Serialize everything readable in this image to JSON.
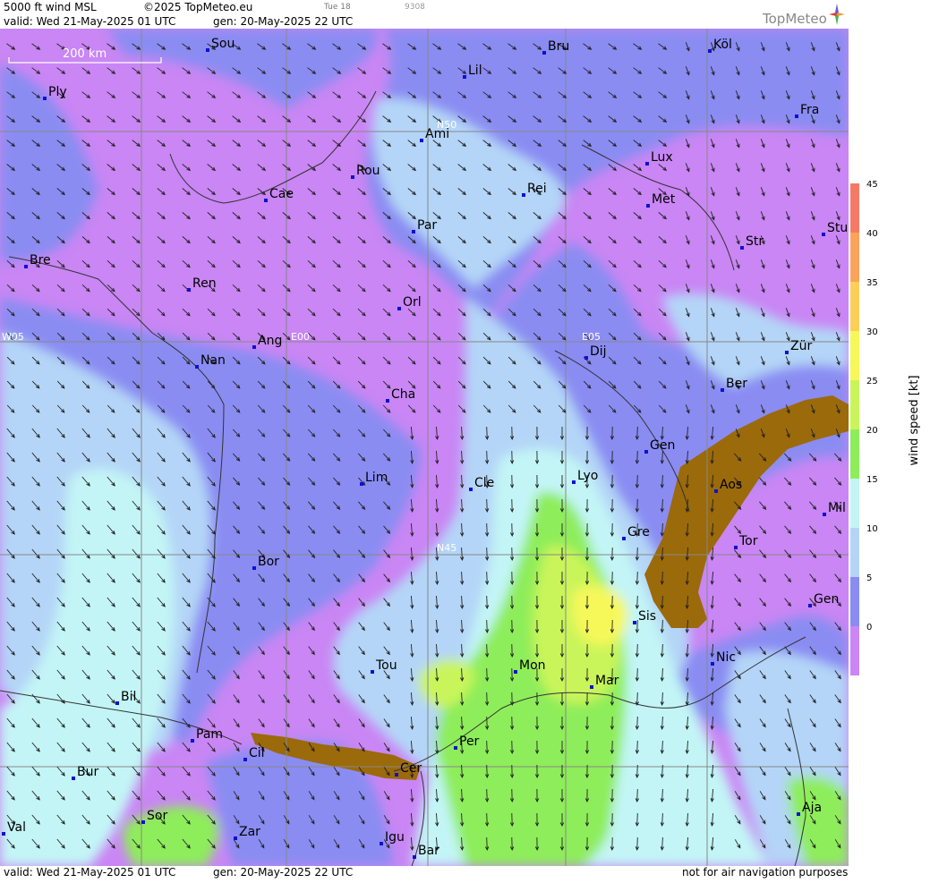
{
  "header": {
    "product": "5000 ft wind MSL",
    "copyright": "©2025 TopMeteo.eu",
    "valid": "valid:  Wed  21-May-2025  01 UTC",
    "generated": "gen: 20-May-2025 22 UTC",
    "small_tag_1": "Tue 18",
    "small_tag_2": "9308",
    "logo": "TopMeteo"
  },
  "footer": {
    "valid": "valid:  Wed  21-May-2025  01 UTC",
    "generated": "gen: 20-May-2025 22 UTC",
    "disclaimer": "not for air navigation purposes"
  },
  "scale": {
    "label": "200 km"
  },
  "grid_labels": [
    "W05",
    "E00",
    "E05",
    "N50",
    "N45"
  ],
  "colorbar": {
    "title": "wind speed [kt]",
    "ticks": [
      "45",
      "40",
      "35",
      "30",
      "25",
      "20",
      "15",
      "10",
      "5",
      "0"
    ],
    "colors": [
      "#f47a66",
      "#f9a45a",
      "#fbcf58",
      "#f6f85a",
      "#c9f55a",
      "#8eed5a",
      "#c3f5f6",
      "#b4d5f7",
      "#8a8cf2",
      "#c986f4"
    ]
  },
  "cities": [
    {
      "name": "Sou"
    },
    {
      "name": "Ply"
    },
    {
      "name": "Lil"
    },
    {
      "name": "Bru"
    },
    {
      "name": "Köl"
    },
    {
      "name": "Ami"
    },
    {
      "name": "Rou"
    },
    {
      "name": "Cae"
    },
    {
      "name": "Rei"
    },
    {
      "name": "Lux"
    },
    {
      "name": "Fra"
    },
    {
      "name": "Met"
    },
    {
      "name": "Par"
    },
    {
      "name": "Bre"
    },
    {
      "name": "Stu"
    },
    {
      "name": "Str"
    },
    {
      "name": "Ren"
    },
    {
      "name": "Orl"
    },
    {
      "name": "Ang"
    },
    {
      "name": "Nan"
    },
    {
      "name": "Dij"
    },
    {
      "name": "Zür"
    },
    {
      "name": "Cha"
    },
    {
      "name": "Ber"
    },
    {
      "name": "Gen"
    },
    {
      "name": "Lim"
    },
    {
      "name": "Cle"
    },
    {
      "name": "Lyo"
    },
    {
      "name": "Aos"
    },
    {
      "name": "Mil"
    },
    {
      "name": "Gre"
    },
    {
      "name": "Tor"
    },
    {
      "name": "Bor"
    },
    {
      "name": "Sis"
    },
    {
      "name": "Gen"
    },
    {
      "name": "Tou"
    },
    {
      "name": "Mon"
    },
    {
      "name": "Mar"
    },
    {
      "name": "Nic"
    },
    {
      "name": "Bil"
    },
    {
      "name": "Pam"
    },
    {
      "name": "Cil"
    },
    {
      "name": "Per"
    },
    {
      "name": "Cer"
    },
    {
      "name": "Bur"
    },
    {
      "name": "Sor"
    },
    {
      "name": "Aja"
    },
    {
      "name": "Val"
    },
    {
      "name": "Zar"
    },
    {
      "name": "Igu"
    },
    {
      "name": "Bar"
    }
  ]
}
